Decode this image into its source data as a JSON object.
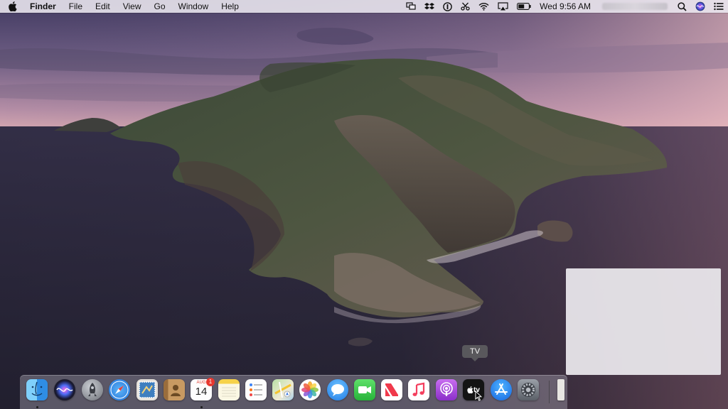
{
  "menubar": {
    "app_name": "Finder",
    "menus": [
      "File",
      "Edit",
      "View",
      "Go",
      "Window",
      "Help"
    ],
    "clock": "Wed 9:56 AM",
    "status_icons": [
      "screen-mirroring-icon",
      "dropbox-icon",
      "1password-icon",
      "scissors-icon",
      "wifi-icon",
      "airplay-icon",
      "battery-icon",
      "spotlight-search-icon",
      "siri-icon",
      "notification-center-icon"
    ]
  },
  "tooltip": {
    "text": "TV"
  },
  "dock": {
    "items": [
      {
        "name": "finder",
        "running": true
      },
      {
        "name": "siri",
        "running": false
      },
      {
        "name": "launchpad",
        "running": false
      },
      {
        "name": "safari",
        "running": false
      },
      {
        "name": "mail",
        "running": false
      },
      {
        "name": "contacts",
        "running": false
      },
      {
        "name": "calendar",
        "running": true
      },
      {
        "name": "notes",
        "running": false
      },
      {
        "name": "reminders",
        "running": false
      },
      {
        "name": "maps",
        "running": false
      },
      {
        "name": "photos",
        "running": false
      },
      {
        "name": "messages",
        "running": false
      },
      {
        "name": "facetime",
        "running": false
      },
      {
        "name": "news",
        "running": false
      },
      {
        "name": "music",
        "running": false
      },
      {
        "name": "podcasts",
        "running": false
      },
      {
        "name": "tv",
        "running": false
      },
      {
        "name": "app-store",
        "running": false
      },
      {
        "name": "system-preferences",
        "running": false
      }
    ],
    "calendar": {
      "month": "AUG",
      "day": "14",
      "badge": "1"
    },
    "tv_label": "tv"
  },
  "colors": {
    "menubar_bg": "#ece8f0",
    "sky_top": "#3c3552",
    "sky_horizon": "#c99aa8",
    "sea": "#2d2a3d",
    "accent_badge": "#e8382f"
  }
}
